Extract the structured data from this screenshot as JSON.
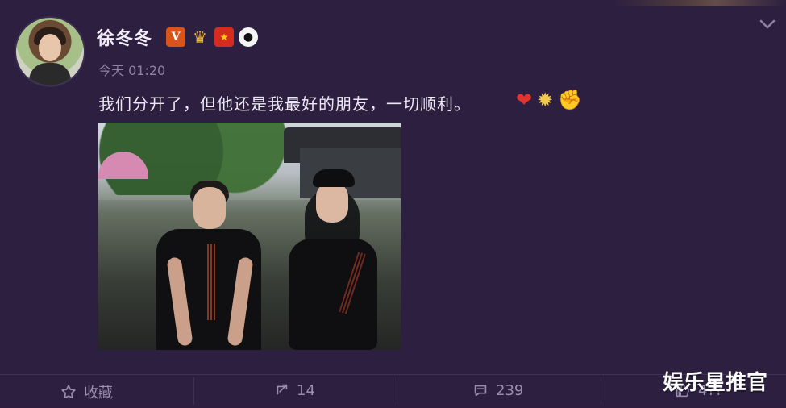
{
  "post": {
    "user": {
      "name": "徐冬冬",
      "badges": [
        "V",
        "crown-icon",
        "china-flag-icon",
        "panda-icon"
      ]
    },
    "time": "今天 01:20",
    "text": "我们分开了，但他还是我最好的朋友，一切顺利。",
    "emojis": [
      "heart-icon",
      "sun-icon",
      "flex-arm-icon"
    ]
  },
  "actions": {
    "favorite_label": "收藏",
    "share_count": "14",
    "comment_count": "239",
    "like_count_partial": "4??"
  },
  "watermark": "娱乐星推官",
  "colors": {
    "background": "#2d1f40",
    "text_primary": "#ece8f4",
    "text_muted": "#8e82a3",
    "badge_v": "#d9541a",
    "heart": "#e0342f"
  }
}
